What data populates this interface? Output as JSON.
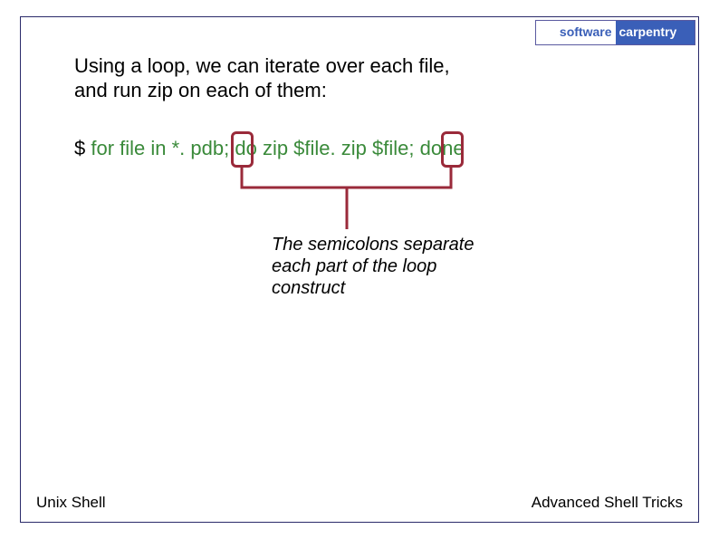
{
  "logo": {
    "left": "software",
    "right": "carpentry"
  },
  "body": {
    "line1": "Using a loop, we can iterate over each file,",
    "line2": "and run zip on each of them:"
  },
  "cmd": {
    "prompt": "$ ",
    "p1": "for file in *. pdb",
    "s1": ";",
    "sp1": " ",
    "p2": "do zip $file. zip $file",
    "s2": ";",
    "sp2": " ",
    "p3": "done"
  },
  "annotation": "The semicolons separate each part of the loop construct",
  "footer": {
    "left": "Unix Shell",
    "right": "Advanced Shell Tricks"
  }
}
